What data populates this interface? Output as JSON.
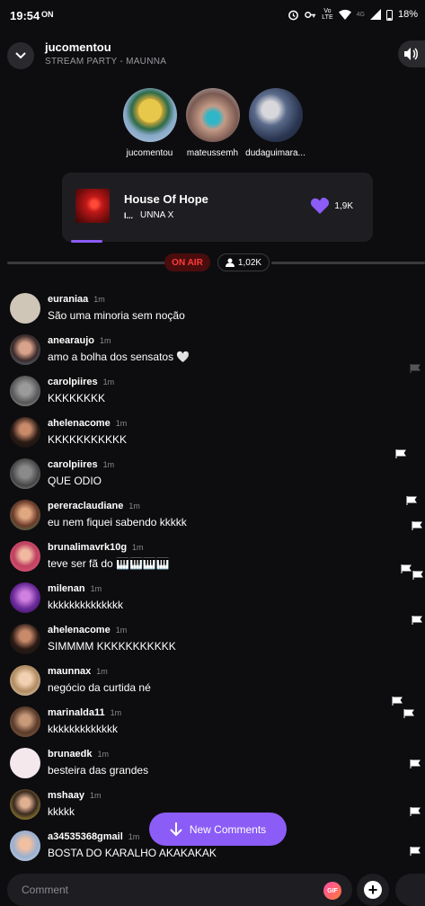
{
  "status_bar": {
    "time": "19:54",
    "left_icon": "ON",
    "lte_top": "Vo",
    "lte_mid": "LTE",
    "signal_label": "4G",
    "battery": "18%"
  },
  "header": {
    "host": "jucomentou",
    "party": "STREAM PARTY - MAUNNA"
  },
  "participants": [
    {
      "name": "jucomentou"
    },
    {
      "name": "mateussemh"
    },
    {
      "name": "dudaguimara..."
    }
  ],
  "now_playing": {
    "title": "House Of Hope",
    "explicit": "I...",
    "artist": "UNNA X",
    "likes": "1,9K"
  },
  "live": {
    "on_air": "ON AIR",
    "listeners": "1,02K"
  },
  "comments": [
    {
      "user": "euraniaa",
      "time": "1m",
      "text": "São uma minoria sem noção"
    },
    {
      "user": "anearaujo",
      "time": "1m",
      "text": "amo a bolha dos sensatos 🤍"
    },
    {
      "user": "carolpiires",
      "time": "1m",
      "text": "KKKKKKKK"
    },
    {
      "user": "ahelenacome",
      "time": "1m",
      "text": "KKKKKKKKKKK"
    },
    {
      "user": "carolpiires",
      "time": "1m",
      "text": "QUE ODIO"
    },
    {
      "user": "pereraclaudiane",
      "time": "1m",
      "text": "eu nem fiquei sabendo kkkkk"
    },
    {
      "user": "brunalimavrk10g",
      "time": "1m",
      "text": "teve ser fã do 🎹🎹🎹🎹"
    },
    {
      "user": "milenan",
      "time": "1m",
      "text": "kkkkkkkkkkkkkk"
    },
    {
      "user": "ahelenacome",
      "time": "1m",
      "text": "SIMMMM KKKKKKKKKKK"
    },
    {
      "user": "maunnax",
      "time": "1m",
      "text": "negócio da curtida né"
    },
    {
      "user": "marinalda11",
      "time": "1m",
      "text": "kkkkkkkkkkkkk"
    },
    {
      "user": "brunaedk",
      "time": "1m",
      "text": "besteira das grandes"
    },
    {
      "user": "mshaay",
      "time": "1m",
      "text": "kkkkk"
    },
    {
      "user": "a34535368gmail",
      "time": "1m",
      "text": "BOSTA DO KARALHO AKAKAKAK"
    }
  ],
  "new_comments_label": "New Comments",
  "comment_input": {
    "placeholder": "Comment",
    "gif": "GIF"
  },
  "colors": {
    "accent": "#8b5cf6",
    "on_air": "#ff3b3b",
    "background": "#0d0d0f"
  }
}
